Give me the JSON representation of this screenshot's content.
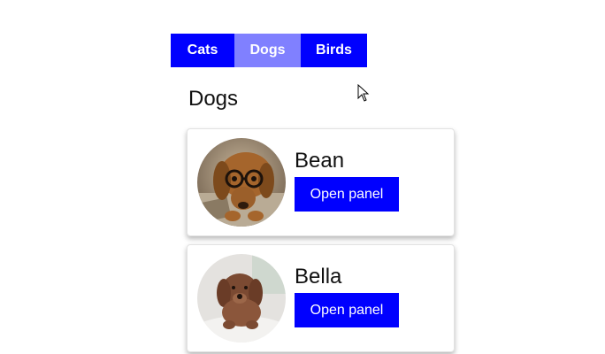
{
  "tabs": [
    {
      "label": "Cats",
      "selected": false
    },
    {
      "label": "Dogs",
      "selected": true
    },
    {
      "label": "Birds",
      "selected": false
    }
  ],
  "section": {
    "title": "Dogs"
  },
  "pets": [
    {
      "name": "Bean",
      "button_label": "Open panel",
      "photo": "dachshund-with-glasses-photo"
    },
    {
      "name": "Bella",
      "button_label": "Open panel",
      "photo": "curly-brown-puppy-photo"
    }
  ],
  "colors": {
    "tab_bg": "#0000ff",
    "tab_selected_bg": "#8080ff",
    "button_bg": "#0000ff",
    "text": "#111111"
  },
  "icons": {
    "cursor": "mouse-pointer-icon"
  }
}
